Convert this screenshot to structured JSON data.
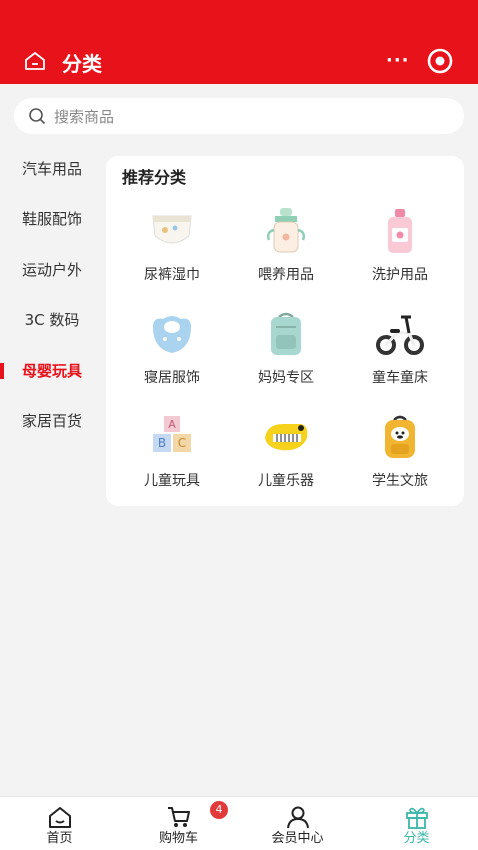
{
  "header": {
    "title": "分类",
    "more": "···"
  },
  "search": {
    "placeholder": "搜索商品"
  },
  "sidebar": {
    "items": [
      {
        "label": "汽车用品"
      },
      {
        "label": "鞋服配饰"
      },
      {
        "label": "运动户外"
      },
      {
        "label": "3C 数码"
      },
      {
        "label": "母婴玩具"
      },
      {
        "label": "家居百货"
      }
    ],
    "active_index": 4
  },
  "recommend": {
    "title": "推荐分类",
    "items": [
      {
        "label": "尿裤湿巾",
        "icon": "diaper-icon"
      },
      {
        "label": "喂养用品",
        "icon": "baby-bottle-icon"
      },
      {
        "label": "洗护用品",
        "icon": "lotion-bottle-icon"
      },
      {
        "label": "寝居服饰",
        "icon": "baby-bib-icon"
      },
      {
        "label": "妈妈专区",
        "icon": "backpack-icon"
      },
      {
        "label": "童车童床",
        "icon": "balance-bike-icon"
      },
      {
        "label": "儿童玩具",
        "icon": "abc-blocks-icon"
      },
      {
        "label": "儿童乐器",
        "icon": "toy-piano-icon"
      },
      {
        "label": "学生文旅",
        "icon": "school-bag-icon"
      }
    ]
  },
  "tabbar": {
    "items": [
      {
        "label": "首页",
        "icon": "home-icon"
      },
      {
        "label": "购物车",
        "icon": "cart-icon"
      },
      {
        "label": "会员中心",
        "icon": "user-icon"
      },
      {
        "label": "分类",
        "icon": "gift-icon"
      }
    ],
    "cart_badge": "4",
    "active_index": 3
  },
  "colors": {
    "brand": "#e8121b",
    "active_tab": "#3bb7a8",
    "badge": "#e23a3a"
  }
}
